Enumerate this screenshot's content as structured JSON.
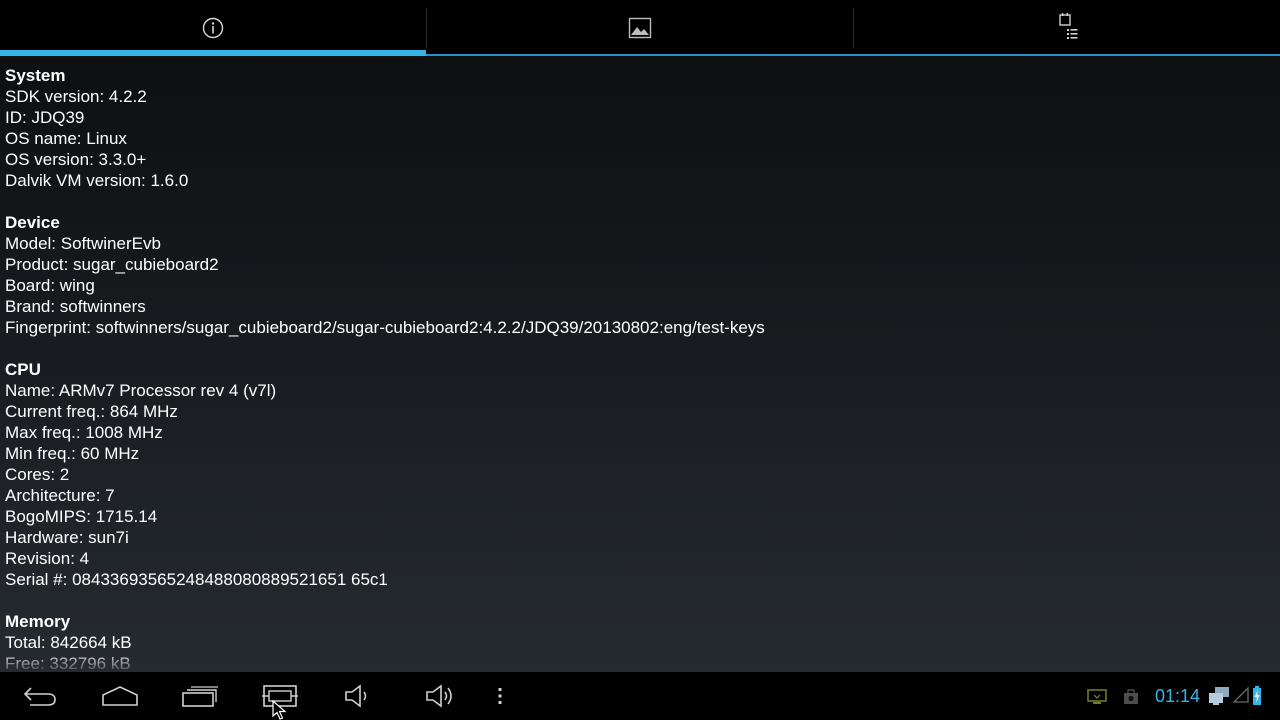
{
  "tabs": [
    {
      "icon": "info-icon",
      "active": true
    },
    {
      "icon": "image-icon",
      "active": false
    },
    {
      "icon": "task-list-icon",
      "active": false
    }
  ],
  "sections": [
    {
      "title": "System",
      "lines": [
        "SDK version: 4.2.2",
        "ID: JDQ39",
        "OS name: Linux",
        "OS version: 3.3.0+",
        "Dalvik VM version: 1.6.0"
      ]
    },
    {
      "title": "Device",
      "lines": [
        "Model: SoftwinerEvb",
        "Product: sugar_cubieboard2",
        "Board: wing",
        "Brand: softwinners",
        "Fingerprint: softwinners/sugar_cubieboard2/sugar-cubieboard2:4.2.2/JDQ39/20130802:eng/test-keys"
      ]
    },
    {
      "title": "CPU",
      "lines": [
        "Name: ARMv7 Processor rev 4 (v7l)",
        "Current freq.: 864 MHz",
        "Max freq.: 1008 MHz",
        "Min freq.: 60 MHz",
        "Cores: 2",
        "Architecture: 7",
        "BogoMIPS: 1715.14",
        "Hardware: sun7i",
        "Revision: 4",
        "Serial #: 08433693565248488080889521651 65c1"
      ]
    },
    {
      "title": "Memory",
      "lines": [
        "Total: 842664 kB",
        "Free: 332796 kB"
      ]
    }
  ],
  "navbar": {
    "buttons": [
      "back-icon",
      "home-icon",
      "recent-apps-icon",
      "screenshot-icon",
      "volume-down-icon",
      "volume-up-icon",
      "overflow-menu-icon"
    ]
  },
  "status": {
    "clock": "01:14",
    "icons": [
      "display-notification-icon",
      "media-notification-icon",
      "ethernet-icon",
      "signal-icon",
      "battery-charging-icon"
    ]
  },
  "colors": {
    "accent": "#33b5e5",
    "text": "#ffffff",
    "bar_background": "#000000"
  }
}
